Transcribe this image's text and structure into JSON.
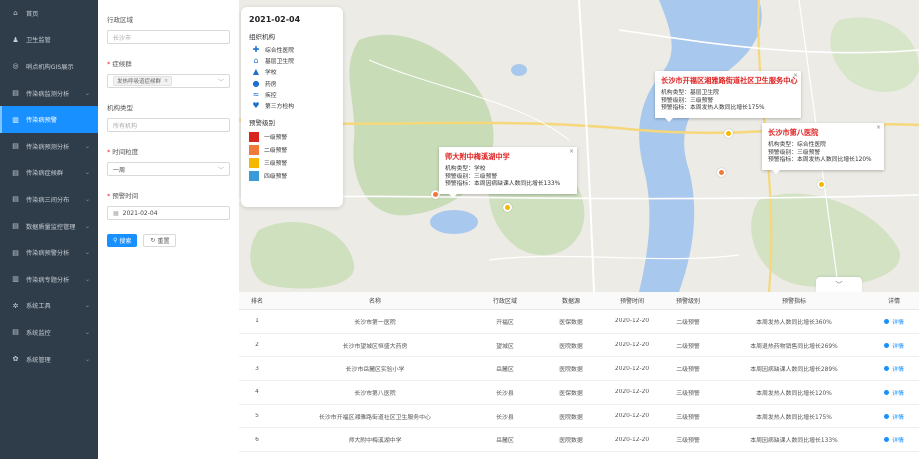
{
  "sidebar": {
    "items": [
      {
        "label": "首页",
        "icon": "home-icon",
        "glyph": "⌂",
        "active": false,
        "chevron": false
      },
      {
        "label": "卫生监管",
        "icon": "users-icon",
        "glyph": "♟",
        "active": false,
        "chevron": false
      },
      {
        "label": "哨点机构GIS展示",
        "icon": "target-icon",
        "glyph": "◎",
        "active": false,
        "chevron": false
      },
      {
        "label": "传染病监测分析",
        "icon": "monitor-icon",
        "glyph": "▤",
        "active": false,
        "chevron": true
      },
      {
        "label": "传染病预警",
        "icon": "bar-chart-icon",
        "glyph": "▥",
        "active": true,
        "chevron": false
      },
      {
        "label": "传染病预测分析",
        "icon": "monitor-icon",
        "glyph": "▤",
        "active": false,
        "chevron": true
      },
      {
        "label": "传染病症候群",
        "icon": "monitor-icon",
        "glyph": "▤",
        "active": false,
        "chevron": true
      },
      {
        "label": "传染病三间分布",
        "icon": "monitor-icon",
        "glyph": "▤",
        "active": false,
        "chevron": true
      },
      {
        "label": "数据质量监控管理",
        "icon": "monitor-icon",
        "glyph": "▤",
        "active": false,
        "chevron": true
      },
      {
        "label": "传染病预警分析",
        "icon": "monitor-icon",
        "glyph": "▤",
        "active": false,
        "chevron": true
      },
      {
        "label": "传染病专题分析",
        "icon": "bar-chart-icon",
        "glyph": "▥",
        "active": false,
        "chevron": true
      },
      {
        "label": "系统工具",
        "icon": "tools-icon",
        "glyph": "✲",
        "active": false,
        "chevron": true
      },
      {
        "label": "系统监控",
        "icon": "monitor-icon",
        "glyph": "▤",
        "active": false,
        "chevron": true
      },
      {
        "label": "系统管理",
        "icon": "gear-icon",
        "glyph": "✿",
        "active": false,
        "chevron": true
      }
    ]
  },
  "filter": {
    "region_label": "行政区域",
    "region_placeholder": "长沙市",
    "disease_label": "症候群",
    "disease_tag": "发热呼吸道症候群",
    "org_type_label": "机构类型",
    "org_type_placeholder": "所有机构",
    "granularity_label": "时间粒度",
    "granularity_value": "一周",
    "warn_time_label": "预警时间",
    "warn_time_value": "2021-02-04",
    "search_label": "搜索",
    "reset_label": "重置"
  },
  "legend": {
    "date": "2021-02-04",
    "org_title": "组织机构",
    "orgs": [
      {
        "label": "综合性医院",
        "icon": "hospital-cross-icon",
        "glyph": "✚"
      },
      {
        "label": "基层卫生院",
        "icon": "clinic-icon",
        "glyph": "⌂"
      },
      {
        "label": "学校",
        "icon": "school-cap-icon",
        "glyph": "▲"
      },
      {
        "label": "药房",
        "icon": "pill-icon",
        "glyph": "●"
      },
      {
        "label": "疾控",
        "icon": "cdc-icon",
        "glyph": "≈"
      },
      {
        "label": "第三方检构",
        "icon": "heart-pulse-icon",
        "glyph": "♥"
      }
    ],
    "level_title": "预警级别",
    "levels": [
      {
        "label": "一级预警",
        "color": "#d9261c"
      },
      {
        "label": "二级预警",
        "color": "#f07a3a"
      },
      {
        "label": "三级预警",
        "color": "#f5b700"
      },
      {
        "label": "四级预警",
        "color": "#3a9bd9"
      }
    ]
  },
  "popups": [
    {
      "title": "长沙市开福区湘雅路街道社区卫生服务中心",
      "lines": [
        "机构类型：基层卫生院",
        "预警级别：三级预警",
        "预警指标：本周发热人数同比增长175%"
      ]
    },
    {
      "title": "长沙市第八医院",
      "lines": [
        "机构类型：综合性医院",
        "预警级别：三级预警",
        "预警指标：本周发热人数同比增长120%"
      ]
    },
    {
      "title": "师大附中梅溪湖中学",
      "lines": [
        "机构类型：学校",
        "预警级别：三级预警",
        "预警指标：本周因病缺课人数同比增长133%"
      ]
    }
  ],
  "table": {
    "headers": [
      "排名",
      "名称",
      "行政区域",
      "数据源",
      "预警时间",
      "预警级别",
      "预警指标",
      "详情"
    ],
    "detail_label": "详情",
    "rows": [
      [
        "1",
        "长沙市第一医院",
        "开福区",
        "医保数据",
        "2020-12-20",
        "二级预警",
        "本周发热人数同比增长360%"
      ],
      [
        "2",
        "长沙市望城区恒盛大药房",
        "望城区",
        "医院数据",
        "2020-12-20",
        "二级预警",
        "本周退热药物销售同比增长269%"
      ],
      [
        "3",
        "长沙市岳麓区实验小学",
        "岳麓区",
        "医院数据",
        "2020-12-20",
        "二级预警",
        "本周因病缺课人数同比增长289%"
      ],
      [
        "4",
        "长沙市第八医院",
        "长沙县",
        "医保数据",
        "2020-12-20",
        "三级预警",
        "本周发热人数同比增长120%"
      ],
      [
        "5",
        "长沙市开福区湘雅路街道社区卫生服务中心",
        "长沙县",
        "医院数据",
        "2020-12-20",
        "三级预警",
        "本周发热人数同比增长175%"
      ],
      [
        "6",
        "师大附中梅溪湖中学",
        "岳麓区",
        "医院数据",
        "2020-12-20",
        "三级预警",
        "本周因病缺课人数同比增长133%"
      ]
    ]
  }
}
